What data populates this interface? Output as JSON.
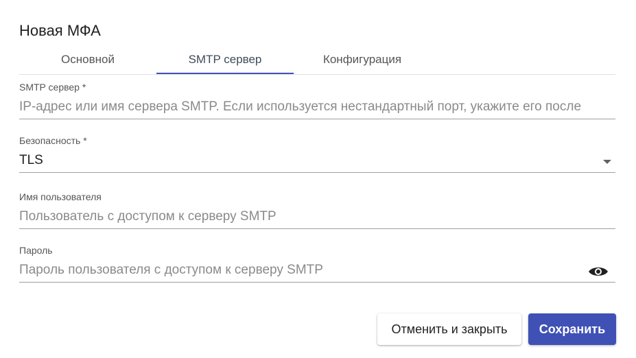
{
  "dialog": {
    "title": "Новая МФА"
  },
  "tabs": [
    {
      "label": "Основной"
    },
    {
      "label": "SMTP сервер",
      "active": true
    },
    {
      "label": "Конфигурация"
    }
  ],
  "form": {
    "smtp_server": {
      "label": "SMTP сервер *",
      "placeholder": "IP-адрес или имя сервера SMTP. Если используется нестандартный порт, укажите его после",
      "value": ""
    },
    "security": {
      "label": "Безопасность *",
      "value": "TLS"
    },
    "username": {
      "label": "Имя пользователя",
      "placeholder": "Пользователь с доступом к серверу SMTP",
      "value": ""
    },
    "password": {
      "label": "Пароль",
      "placeholder": "Пароль пользователя с доступом к серверу SMTP",
      "value": ""
    }
  },
  "buttons": {
    "cancel_label": "Отменить и закрыть",
    "save_label": "Сохранить"
  },
  "icons": {
    "dropdown": "chevron-down-icon",
    "password_toggle": "eye-icon"
  },
  "colors": {
    "accent": "#3f51b5",
    "save_text": "#ffffff"
  }
}
